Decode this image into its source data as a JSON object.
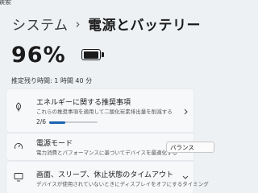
{
  "header": {
    "search_label": "検索",
    "breadcrumb_parent": "システム",
    "breadcrumb_separator": "›",
    "breadcrumb_current": "電源とバッテリー"
  },
  "battery": {
    "percent_text": "96%",
    "level": 0.96,
    "remaining_text": "推定残り時間: 1 時間 40 分"
  },
  "eco_card": {
    "icon": "leaf-icon",
    "title": "エネルギーに関する推奨事項",
    "description": "これらの推奨事項を適用して二酸化炭素排出量を削減する",
    "progress_text": "2/6",
    "progress_value": 2,
    "progress_total": 6
  },
  "power_mode_card": {
    "icon": "power-mode-icon",
    "title": "電源モード",
    "description": "電力消費とパフォーマンスに基づいてデバイスを最適化する",
    "selected_value": "バランス"
  },
  "sleep_card": {
    "icon": "monitor-icon",
    "title": "画面、スリープ、休止状態のタイムアウト",
    "description": "デバイスが使用されていないときにディスプレイをオフにするタイミング"
  },
  "colors": {
    "accent": "#1a63b0",
    "background": "#eef1f4",
    "card": "#f7f8fa"
  }
}
